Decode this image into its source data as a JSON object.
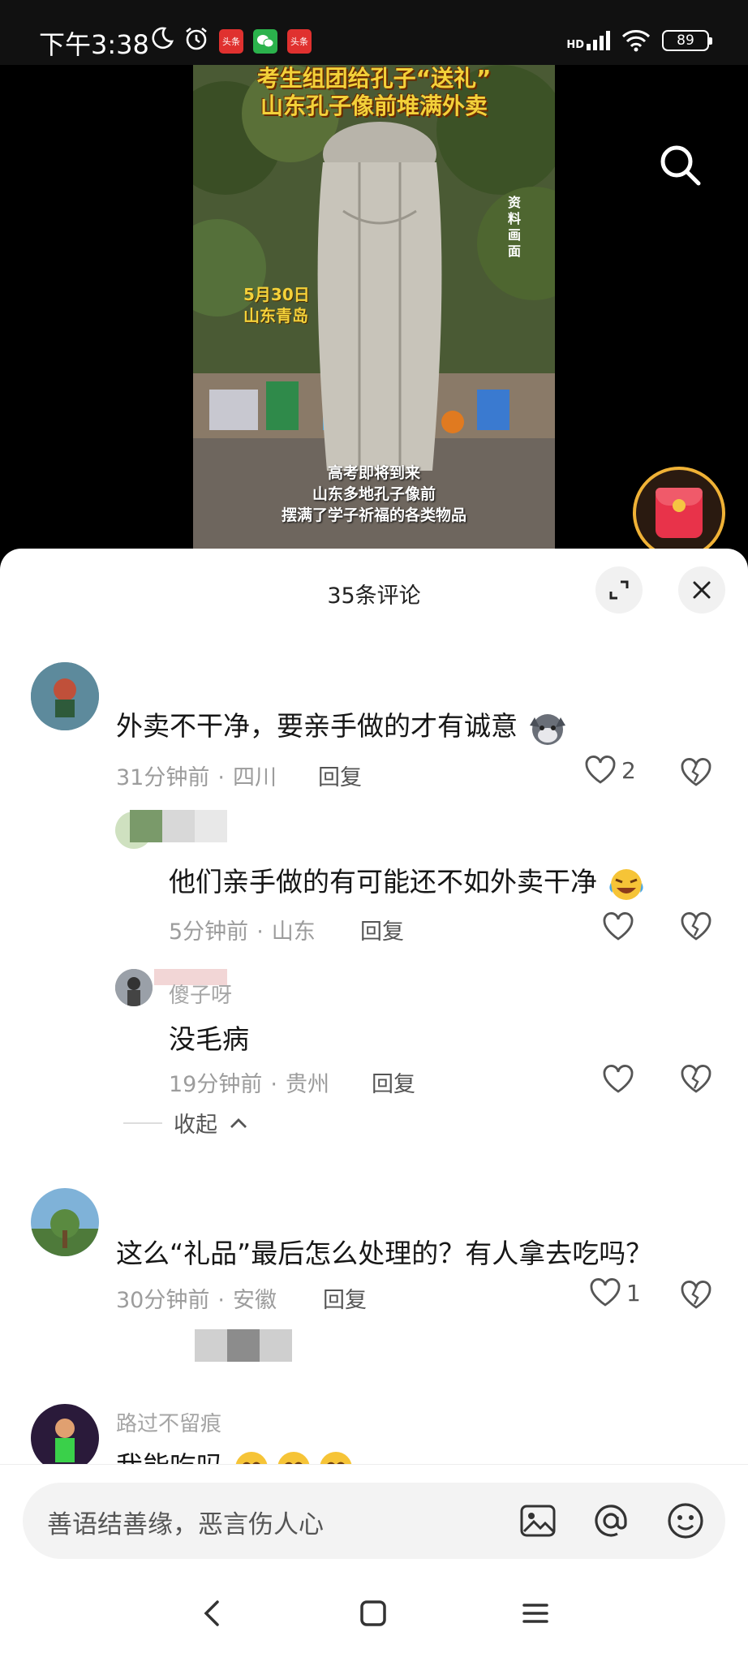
{
  "status_bar": {
    "time": "下午3:38",
    "network": "HD",
    "battery": "89",
    "apps": [
      "头条",
      "微信",
      "头条"
    ]
  },
  "video": {
    "title_line1": "考生组团给孔子“送礼”",
    "title_line2": "山东孔子像前堆满外卖",
    "date_line1": "5月30日",
    "date_line2": "山东青岛",
    "vertical_tag": "资料画面",
    "subtitle_line1": "高考即将到来",
    "subtitle_line2": "山东多地孔子像前",
    "subtitle_line3": "摆满了学子祈福的各类物品"
  },
  "sheet": {
    "title": "35条评论"
  },
  "comments": [
    {
      "text": "外卖不干净，要亲手做的才有诚意",
      "time": "31分钟前",
      "location": "四川",
      "reply": "回复",
      "likes": "2"
    },
    {
      "text": "他们亲手做的有可能还不如外卖干净",
      "time": "5分钟前",
      "location": "山东",
      "reply": "回复"
    },
    {
      "username": "傻子呀",
      "text": "没毛病",
      "time": "19分钟前",
      "location": "贵州",
      "reply": "回复"
    },
    {
      "text": "这么“礼品”最后怎么处理的？有人拿去吃吗？",
      "time": "30分钟前",
      "location": "安徽",
      "reply": "回复",
      "likes": "1"
    },
    {
      "username": "路过不留痕",
      "text": "我能吃吗"
    }
  ],
  "collapse_label": "收起",
  "input": {
    "placeholder": "善语结善缘，恶言伤人心"
  },
  "colors": {
    "title_yellow": "#f3d13a",
    "redpacket": "#e8334a",
    "sheet_bg": "#ffffff",
    "meta_gray": "#9c9c9c"
  },
  "icons": [
    "moon-icon",
    "alarm-icon",
    "signal-icon",
    "wifi-icon",
    "search-icon",
    "expand-icon",
    "close-icon",
    "heart-icon",
    "broken-heart-icon",
    "image-icon",
    "at-icon",
    "emoji-icon",
    "back-icon",
    "home-icon",
    "menu-icon"
  ]
}
